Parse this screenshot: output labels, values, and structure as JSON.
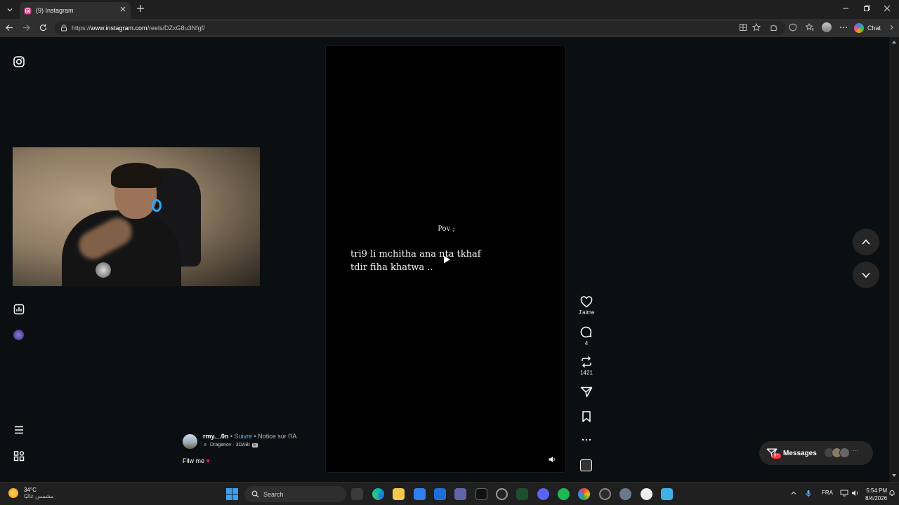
{
  "browser": {
    "tab_title": "(9) Instagram",
    "url_prefix": "https://",
    "url_host": "www.instagram.com",
    "url_path": "/reels/DZxG8u3Nfgf/",
    "chat_label": "Chat"
  },
  "reel": {
    "pov": "Pov ;",
    "line1": "tri9 li mchitha ana nta tkhaf",
    "line2": "tdir fiha khatwa .."
  },
  "actions": {
    "like_label": "J'aime",
    "comments": "4",
    "reposts": "1421"
  },
  "author": {
    "username": "rmy._.0n",
    "sep1": " • ",
    "follow": "Suivre",
    "sep2": " • ",
    "ai_notice": "Notice sur l'IA",
    "music_icon": "♬",
    "music": "Draganov · 3DABI",
    "explicit": "E",
    "caption": "Fllw me",
    "caption_emoji": "♥"
  },
  "messages": {
    "label": "Messages",
    "badge": "9+",
    "more": "···"
  },
  "taskbar": {
    "temperature": "34°C",
    "weather_desc": "مشمس غالبًا",
    "search_placeholder": "Search",
    "language": "FRA",
    "time": "5:54 PM",
    "date": "8/4/2026"
  },
  "colors": {
    "accent_link": "#6aa8ff",
    "badge": "#ff3040",
    "heart": "#e0245e"
  }
}
